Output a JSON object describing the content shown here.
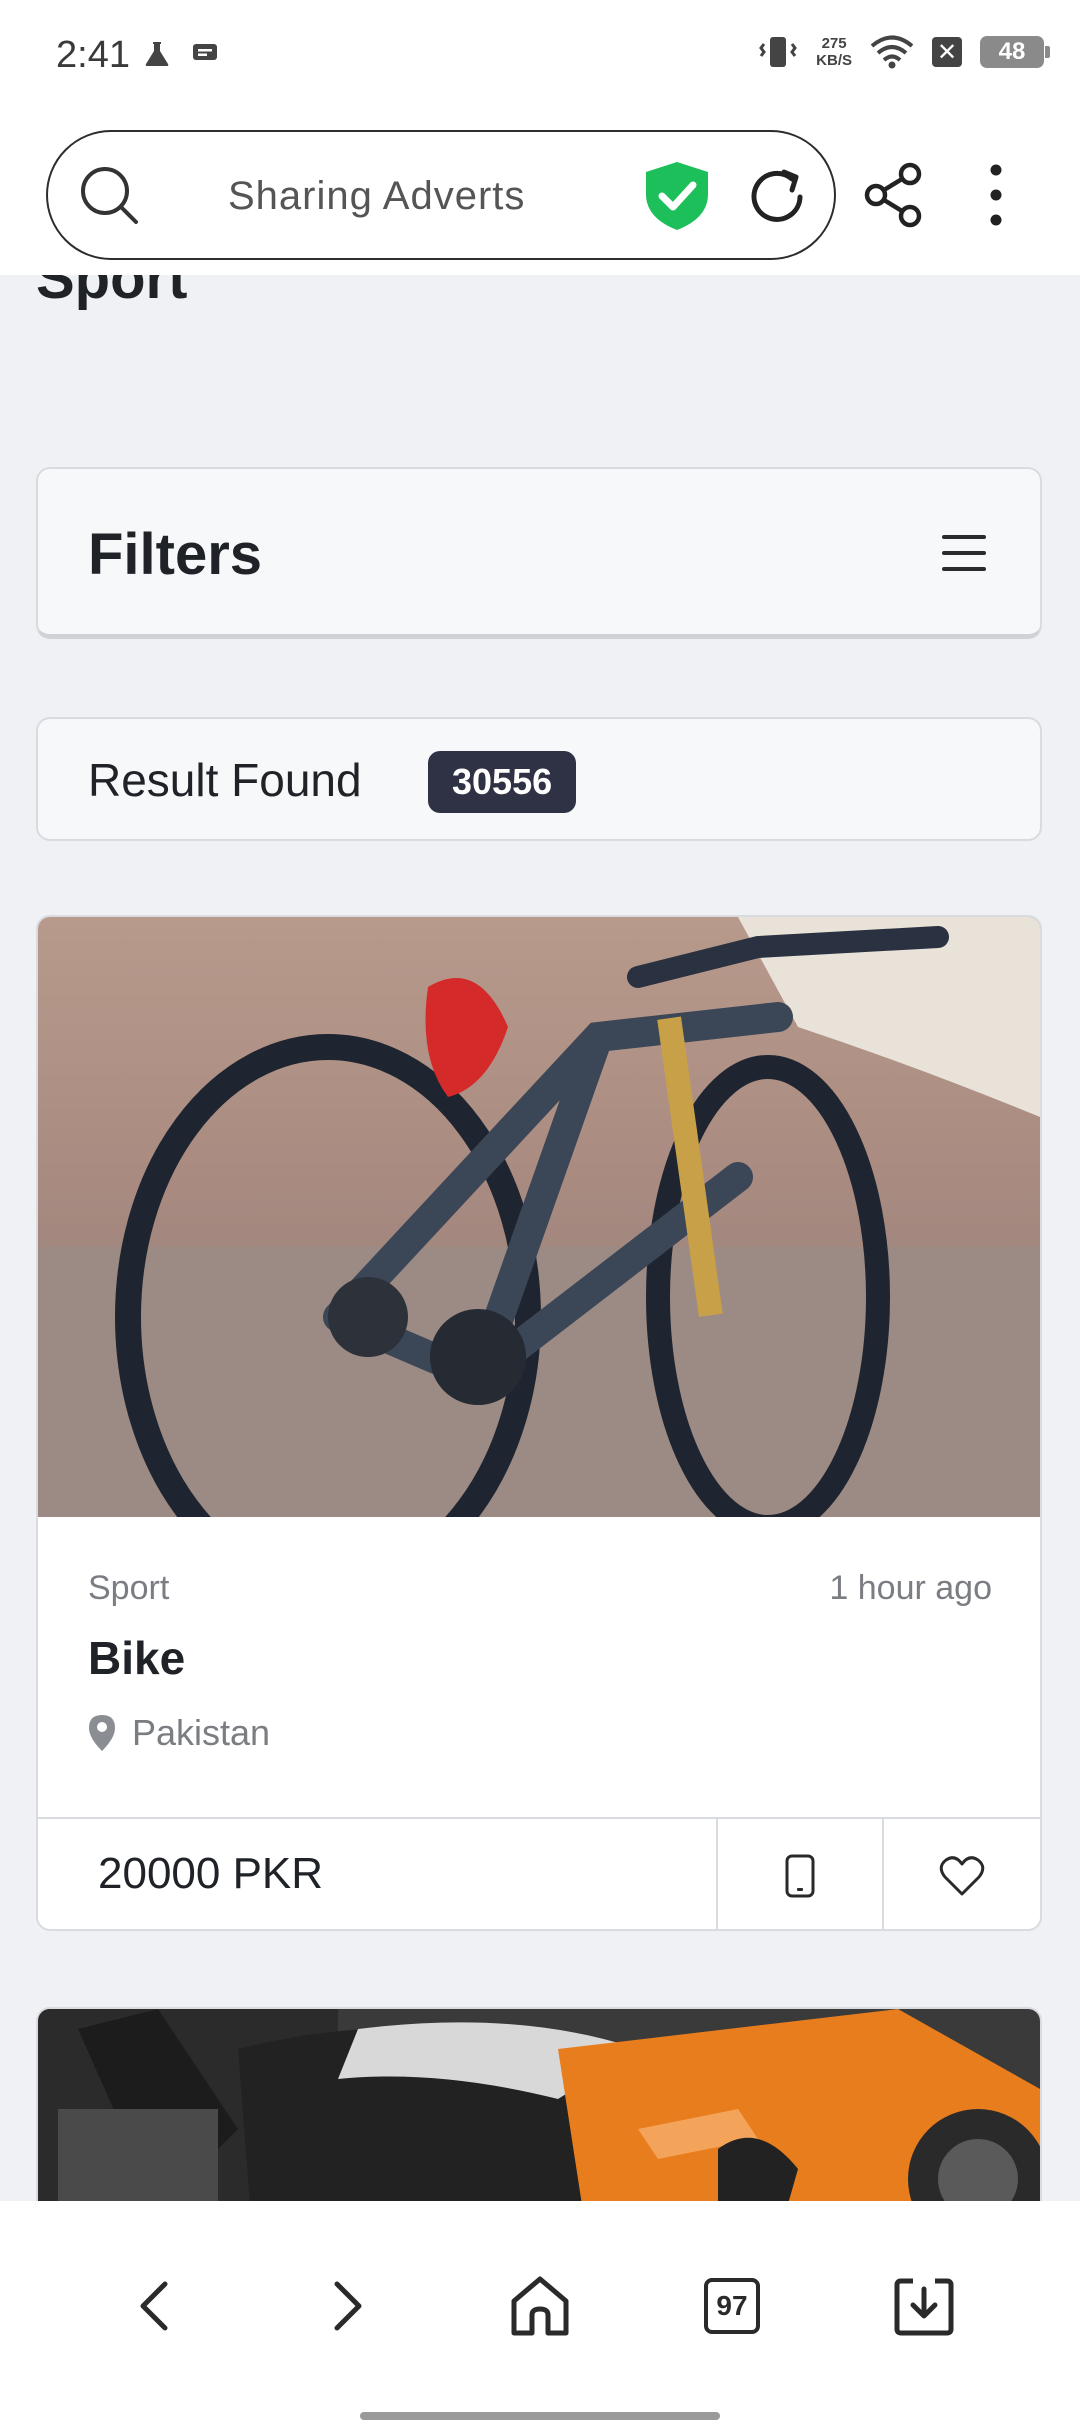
{
  "status_bar": {
    "time": "2:41",
    "net_speed_value": "275",
    "net_speed_unit": "KB/S",
    "battery": "48",
    "icons": [
      "flask-icon",
      "message-icon",
      "vibrate-icon",
      "wifi-icon",
      "sim-off-icon",
      "battery-icon"
    ]
  },
  "browser": {
    "url_text": "Sharing Adverts",
    "icons": [
      "search-icon",
      "shield-check-icon",
      "reload-icon",
      "share-icon",
      "more-vert-icon"
    ],
    "shield_color": "#1dbf5a"
  },
  "page": {
    "heading": "Sport",
    "filters_title": "Filters",
    "result_label": "Result Found",
    "result_count": "30556"
  },
  "listings": [
    {
      "category": "Sport",
      "time": "1 hour ago",
      "title": "Bike",
      "location": "Pakistan",
      "price": "20000 PKR"
    }
  ],
  "bottom_nav": {
    "tabs_count": "97",
    "icons": [
      "back-icon",
      "forward-icon",
      "home-icon",
      "tabs-icon",
      "download-icon"
    ]
  }
}
